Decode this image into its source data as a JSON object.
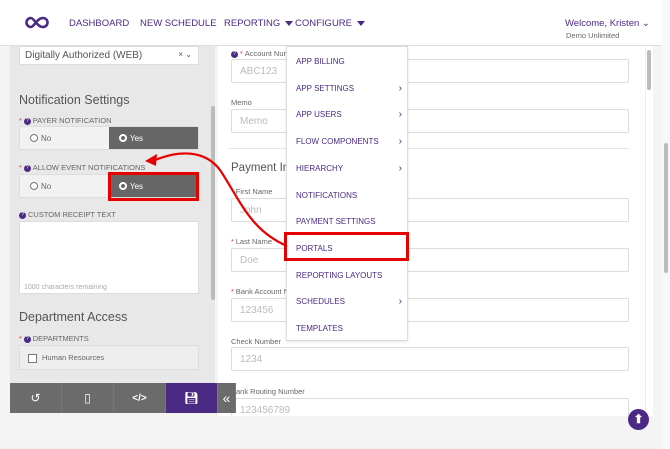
{
  "header": {
    "nav": [
      "DASHBOARD",
      "NEW SCHEDULE",
      "REPORTING",
      "CONFIGURE"
    ],
    "welcome": "Welcome, Kristen",
    "org": "Demo Unlimited"
  },
  "left": {
    "select_value": "Digitally Authorized (WEB)",
    "notif_title": "Notification Settings",
    "payer_label": "PAYER NOTIFICATION",
    "event_label": "ALLOW EVENT NOTIFICATIONS",
    "no": "No",
    "yes": "Yes",
    "receipt_label": "CUSTOM RECEIPT TEXT",
    "chars_remaining": "1000 characters remaining",
    "dept_title": "Department Access",
    "dept_label": "DEPARTMENTS",
    "dept_option": "Human Resources"
  },
  "form": {
    "account_label": "Account Nur",
    "account_ph": "ABC123",
    "memo_label": "Memo",
    "memo_ph": "Memo",
    "section": "Payment Int",
    "first_label": "First Name",
    "first_ph": "John",
    "last_label": "Last Name",
    "last_ph": "Doe",
    "bank_label": "Bank Account N",
    "bank_ph": "123456",
    "check_label": "Check Number",
    "check_ph": "1234",
    "routing_label": "Bank Routing Number",
    "routing_ph": "123456789"
  },
  "menu": {
    "items": [
      {
        "label": "APP BILLING"
      },
      {
        "label": "APP SETTINGS",
        "sub": "›"
      },
      {
        "label": "APP USERS",
        "sub": "›"
      },
      {
        "label": "FLOW COMPONENTS",
        "sub": "›"
      },
      {
        "label": "HIERARCHY",
        "sub": "›"
      },
      {
        "label": "NOTIFICATIONS"
      },
      {
        "label": "PAYMENT SETTINGS"
      },
      {
        "label": "PORTALS"
      },
      {
        "label": "REPORTING LAYOUTS"
      },
      {
        "label": "SCHEDULES",
        "sub": "›"
      },
      {
        "label": "TEMPLATES"
      }
    ]
  },
  "colors": {
    "brand": "#4b2a85",
    "highlight": "#e60000"
  }
}
